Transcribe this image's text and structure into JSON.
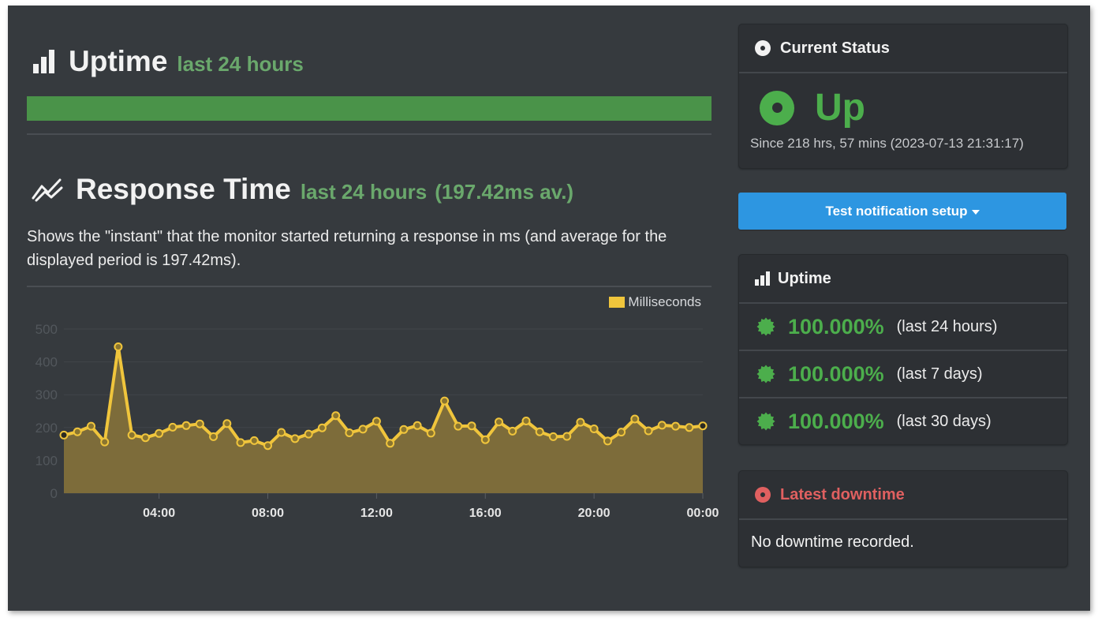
{
  "uptime_section": {
    "title": "Uptime",
    "subtitle": "last 24 hours",
    "bar_percent": 100,
    "bar_color": "#4a9349"
  },
  "response_section": {
    "title": "Response Time",
    "subtitle": "last 24 hours",
    "average": "(197.42ms av.)",
    "description": "Shows the \"instant\" that the monitor started returning a response in ms (and average for the displayed period is 197.42ms)."
  },
  "chart_data": {
    "type": "area",
    "title": "",
    "xlabel": "",
    "ylabel": "",
    "legend": {
      "label": "Milliseconds",
      "color": "#f0c53c",
      "placement": "top-right"
    },
    "ylim": [
      0,
      500
    ],
    "yticks": [
      "0",
      "100",
      "200",
      "300",
      "400",
      "500"
    ],
    "xticks": [
      {
        "label": "04:00",
        "hour": 4
      },
      {
        "label": "08:00",
        "hour": 8
      },
      {
        "label": "12:00",
        "hour": 12
      },
      {
        "label": "16:00",
        "hour": 16
      },
      {
        "label": "20:00",
        "hour": 20
      },
      {
        "label": "00:00",
        "hour": 24
      }
    ],
    "x_hours_start": 0.5,
    "x_hours_step": 0.5,
    "grid": true,
    "series": [
      {
        "name": "Milliseconds",
        "color": "#f0c53c",
        "fill": "#7d6c3a",
        "values": [
          177,
          187,
          204,
          156,
          446,
          177,
          169,
          182,
          201,
          206,
          211,
          172,
          212,
          154,
          160,
          145,
          185,
          166,
          180,
          199,
          236,
          184,
          195,
          219,
          152,
          194,
          206,
          183,
          281,
          204,
          205,
          163,
          217,
          189,
          220,
          187,
          172,
          173,
          216,
          196,
          159,
          186,
          226,
          190,
          207,
          204,
          200,
          205
        ]
      }
    ]
  },
  "current_status": {
    "header": "Current Status",
    "status": "Up",
    "since": "Since 218 hrs, 57 mins (2023-07-13 21:31:17)",
    "status_color": "#4cae4c"
  },
  "test_button": {
    "label": "Test notification setup"
  },
  "uptime_panel": {
    "header": "Uptime",
    "rows": [
      {
        "percent": "100.000%",
        "period": "(last 24 hours)"
      },
      {
        "percent": "100.000%",
        "period": "(last 7 days)"
      },
      {
        "percent": "100.000%",
        "period": "(last 30 days)"
      }
    ]
  },
  "downtime_panel": {
    "header": "Latest downtime",
    "message": "No downtime recorded.",
    "header_color": "#e06060"
  }
}
